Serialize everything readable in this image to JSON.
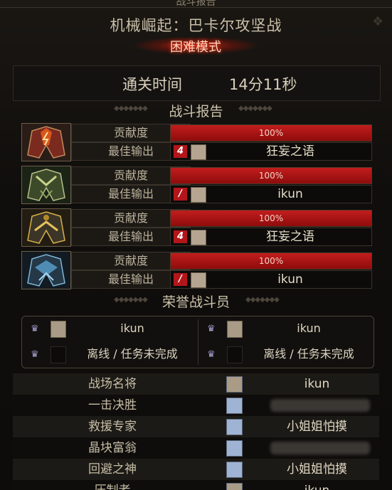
{
  "window": {
    "title": "战斗报告"
  },
  "dungeon": {
    "name": "机械崛起：巴卡尔攻坚战",
    "mode": "困难模式"
  },
  "clear": {
    "label": "通关时间",
    "value": "14分11秒"
  },
  "report": {
    "heading": "战斗报告",
    "contribution_label": "贡献度",
    "best_dps_label": "最佳输出",
    "bosses": [
      {
        "portrait_icon": "boss-red-helmet-icon",
        "contribution": "100%",
        "contribution_value": 1.0,
        "class_icon": "4",
        "best_player": "狂妄之语"
      },
      {
        "portrait_icon": "boss-green-helmet-icon",
        "contribution": "100%",
        "contribution_value": 1.0,
        "class_icon": "/",
        "best_player": "ikun"
      },
      {
        "portrait_icon": "boss-gold-helmet-icon",
        "contribution": "100%",
        "contribution_value": 1.0,
        "class_icon": "4",
        "best_player": "狂妄之语"
      },
      {
        "portrait_icon": "boss-blue-helmet-icon",
        "contribution": "100%",
        "contribution_value": 1.0,
        "class_icon": "/",
        "best_player": "ikun"
      }
    ]
  },
  "honor": {
    "heading": "荣誉战斗员",
    "members": [
      {
        "name": "ikun"
      },
      {
        "name": "ikun"
      },
      {
        "name": "离线 / 任务未完成"
      },
      {
        "name": "离线 / 任务未完成"
      }
    ]
  },
  "awards": [
    {
      "title": "战场名将",
      "player": "ikun"
    },
    {
      "title": "一击决胜",
      "player": ""
    },
    {
      "title": "救援专家",
      "player": "小姐姐怕摸"
    },
    {
      "title": "晶块富翁",
      "player": ""
    },
    {
      "title": "回避之神",
      "player": "小姐姐怕摸"
    },
    {
      "title": "压制者",
      "player": "ikun"
    }
  ],
  "colors": {
    "bar_red": "#c21d1d",
    "mode_glow": "#ff3a1a"
  }
}
